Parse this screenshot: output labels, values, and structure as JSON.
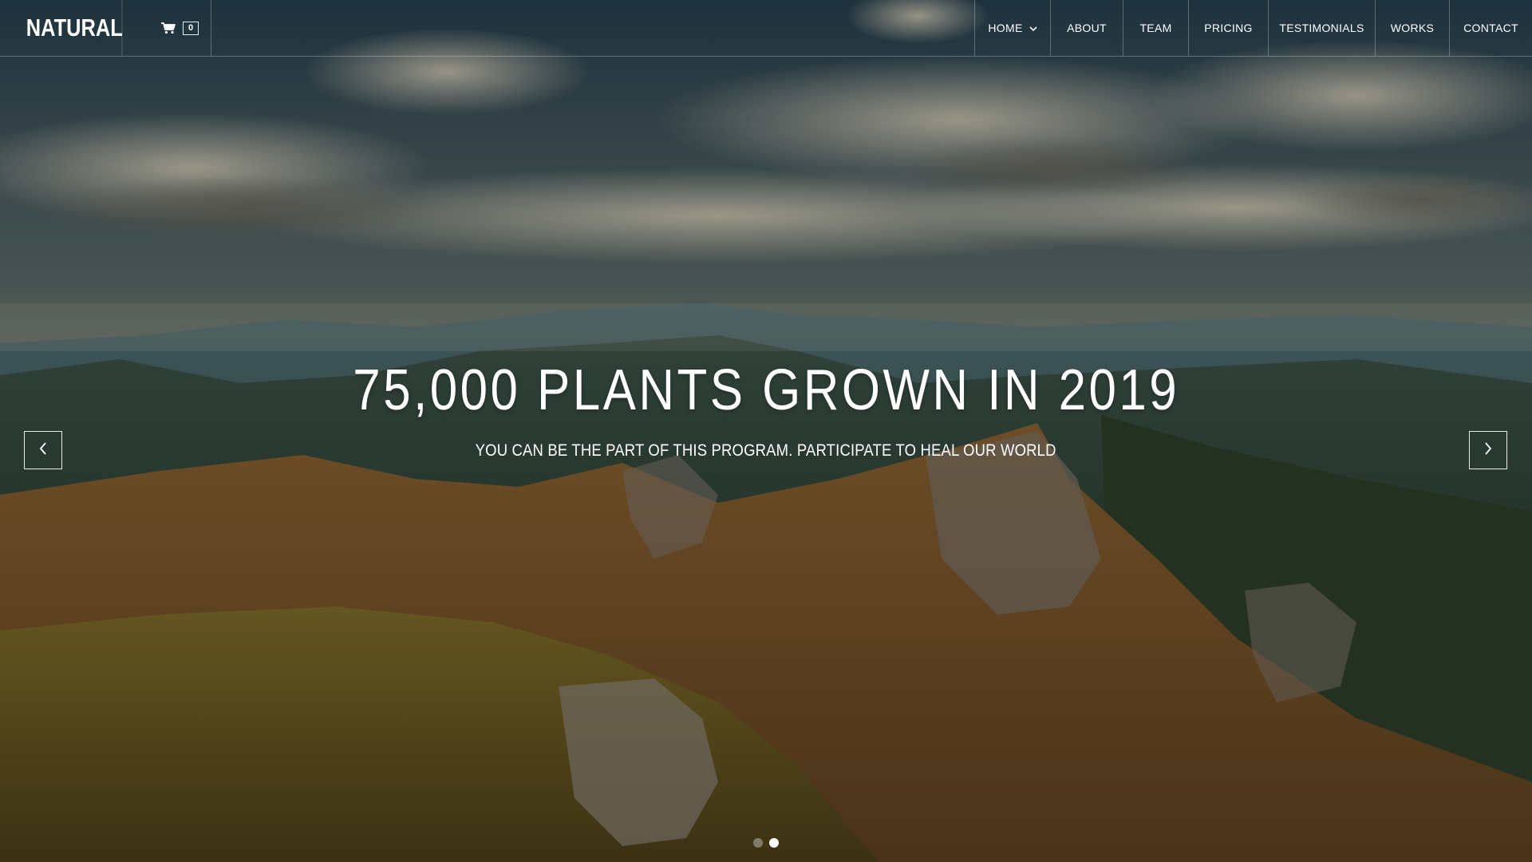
{
  "brand": {
    "name": "NATURAL"
  },
  "cart": {
    "icon": "cart-icon",
    "count": "0"
  },
  "nav": {
    "items": [
      {
        "label": "HOME",
        "has_dropdown": true
      },
      {
        "label": "ABOUT"
      },
      {
        "label": "TEAM"
      },
      {
        "label": "PRICING"
      },
      {
        "label": "TESTIMONIALS"
      },
      {
        "label": "WORKS"
      },
      {
        "label": "CONTACT"
      }
    ]
  },
  "hero": {
    "title": "75,000 PLANTS GROWN IN 2019",
    "subtitle": "YOU CAN BE THE PART OF THIS PROGRAM. PARTICIPATE TO HEAL OUR WORLD"
  },
  "slider": {
    "prev_icon": "chevron-left-icon",
    "next_icon": "chevron-right-icon",
    "slide_count": 2,
    "active_slide": 2
  },
  "colors": {
    "text": "#ffffff",
    "divider": "rgba(255,255,255,0.28)"
  }
}
